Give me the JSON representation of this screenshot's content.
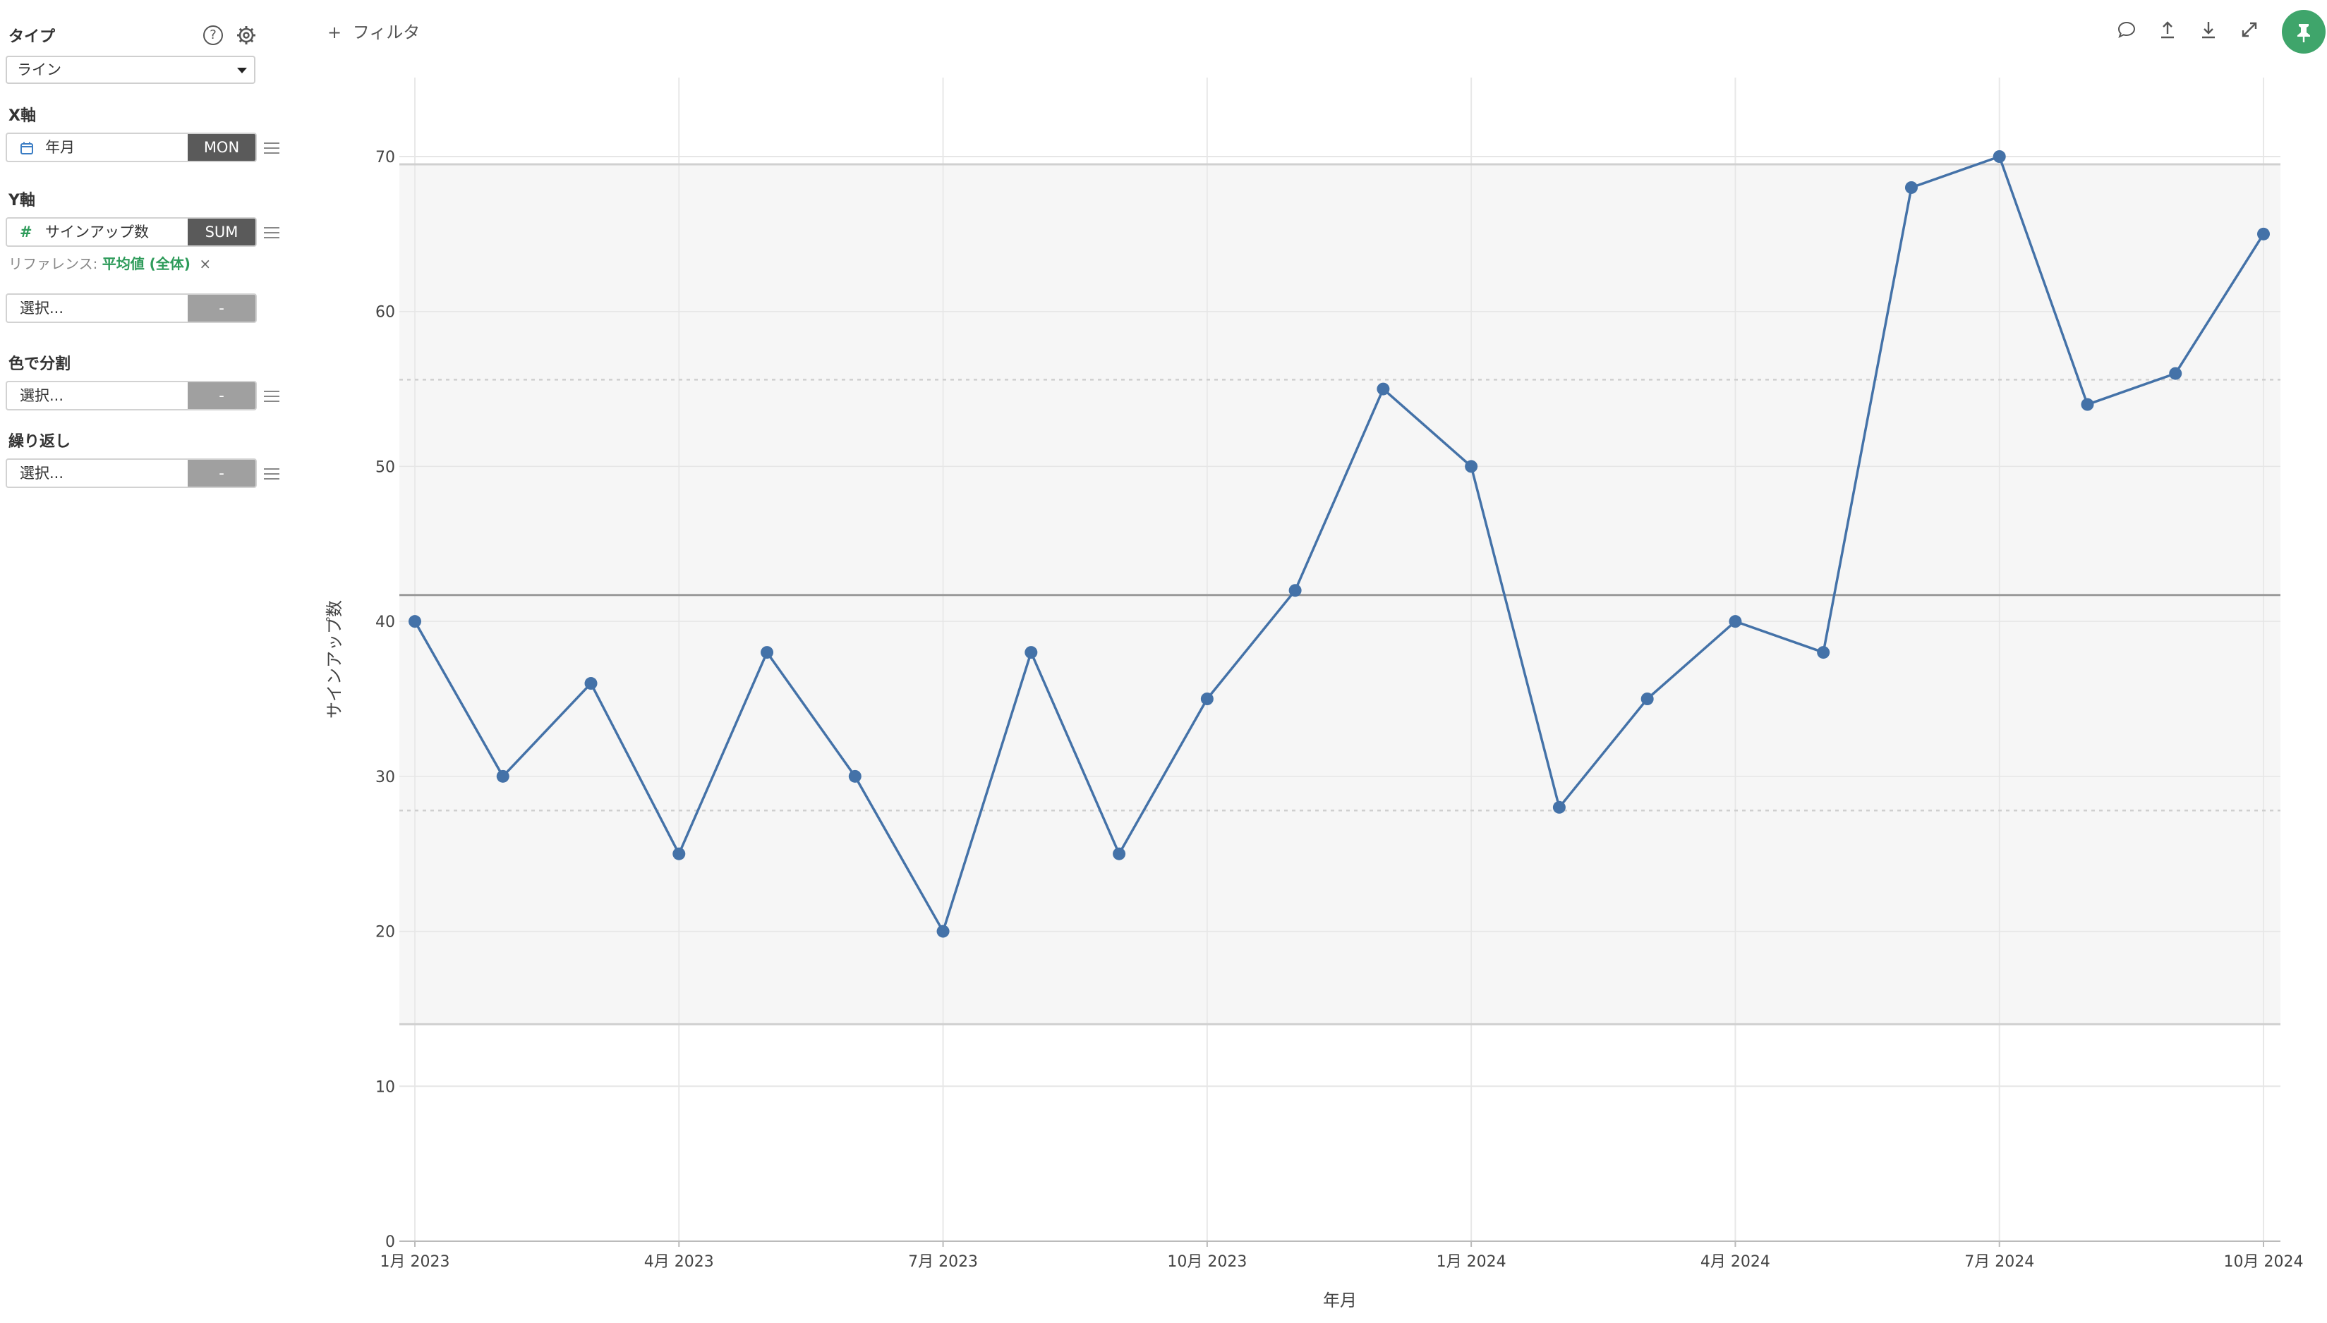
{
  "sidebar": {
    "type_label": "タイプ",
    "type_value": "ライン",
    "x_axis_label": "X軸",
    "x_field": "年月",
    "x_agg": "MON",
    "y_axis_label": "Y軸",
    "y_field": "サインアップ数",
    "y_agg": "SUM",
    "reference_label": "リファレンス:",
    "reference_value": "平均値 (全体)",
    "reference_close": "×",
    "extra_select": "選択...",
    "extra_agg": "-",
    "color_label": "色で分割",
    "color_select": "選択...",
    "color_agg": "-",
    "repeat_label": "繰り返し",
    "repeat_select": "選択...",
    "repeat_agg": "-"
  },
  "toolbar": {
    "filter_label": "フィルタ",
    "filter_plus": "+"
  },
  "colors": {
    "line": "#4472a8",
    "accent_green": "#3fa56b",
    "band_fill": "#f4f4f4",
    "ref_line": "#999999"
  },
  "chart_data": {
    "type": "line",
    "xlabel": "年月",
    "ylabel": "サインアップ数",
    "x": [
      "2023-01",
      "2023-02",
      "2023-03",
      "2023-04",
      "2023-05",
      "2023-06",
      "2023-07",
      "2023-08",
      "2023-09",
      "2023-10",
      "2023-11",
      "2023-12",
      "2024-01",
      "2024-02",
      "2024-03",
      "2024-04",
      "2024-05",
      "2024-06",
      "2024-07",
      "2024-08",
      "2024-09",
      "2024-10"
    ],
    "values": [
      40,
      30,
      36,
      25,
      38,
      30,
      20,
      38,
      25,
      35,
      42,
      55,
      50,
      28,
      35,
      40,
      38,
      68,
      70,
      54,
      56,
      65
    ],
    "xtick_labels": [
      "1月 2023",
      "4月 2023",
      "7月 2023",
      "10月 2023",
      "1月 2024",
      "4月 2024",
      "7月 2024",
      "10月 2024"
    ],
    "xtick_dates": [
      "2023-01",
      "2023-04",
      "2023-07",
      "2023-10",
      "2024-01",
      "2024-04",
      "2024-07",
      "2024-10"
    ],
    "ylim": [
      0,
      70
    ],
    "yticks": [
      0,
      10,
      20,
      30,
      40,
      50,
      60,
      70
    ],
    "reference": {
      "name": "平均値 (全体)",
      "mean": 41.7,
      "sd1": [
        27.8,
        55.6
      ],
      "sd2": [
        14.0,
        69.5
      ]
    },
    "grid": true
  }
}
